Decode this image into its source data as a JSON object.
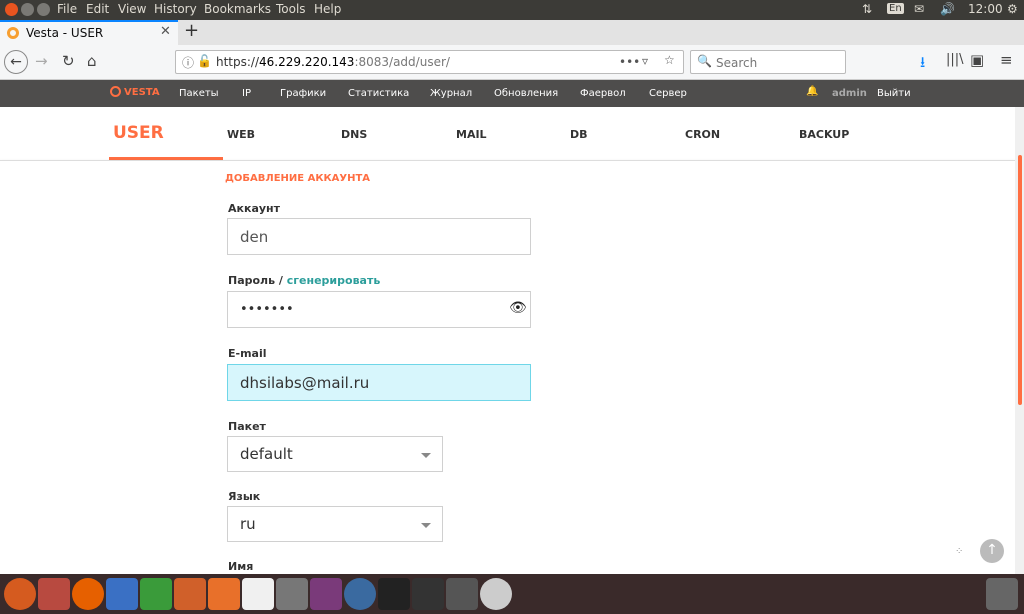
{
  "menubar": {
    "items": [
      "File",
      "Edit",
      "View",
      "History",
      "Bookmarks",
      "Tools",
      "Help"
    ],
    "keyboard": "En",
    "time": "12:00"
  },
  "tab": {
    "title": "Vesta - USER"
  },
  "nav": {
    "url_prefix": "https://",
    "url_host": "46.229.220.143",
    "url_rest": ":8083/add/user/",
    "search_placeholder": "Search",
    "page_actions": "•••"
  },
  "vesta_menu": {
    "logo": "VESTA",
    "items": [
      "Пакеты",
      "IP",
      "Графики",
      "Статистика",
      "Журнал",
      "Обновления",
      "Фаервол",
      "Сервер"
    ],
    "user": "admin",
    "logout": "Выйти"
  },
  "vesta_tabs": {
    "active": "USER",
    "items": [
      "WEB",
      "DNS",
      "MAIL",
      "DB",
      "CRON",
      "BACKUP"
    ]
  },
  "subheader": "ДОБАВЛЕНИЕ АККАУНТА",
  "form": {
    "account_label": "Аккаунт",
    "account_value": "den",
    "password_label": "Пароль /",
    "generate_link": "сгенерировать",
    "password_value": "•••••••",
    "email_label": "E-mail",
    "email_value": "dhsilabs@mail.ru",
    "package_label": "Пакет",
    "package_value": "default",
    "language_label": "Язык",
    "language_value": "ru",
    "name_label": "Имя"
  },
  "colors": {
    "accent": "#ff6e42",
    "link": "#2c9e9b",
    "focus_bg": "#d7f6fc",
    "menubar": "#4e4d4c"
  }
}
